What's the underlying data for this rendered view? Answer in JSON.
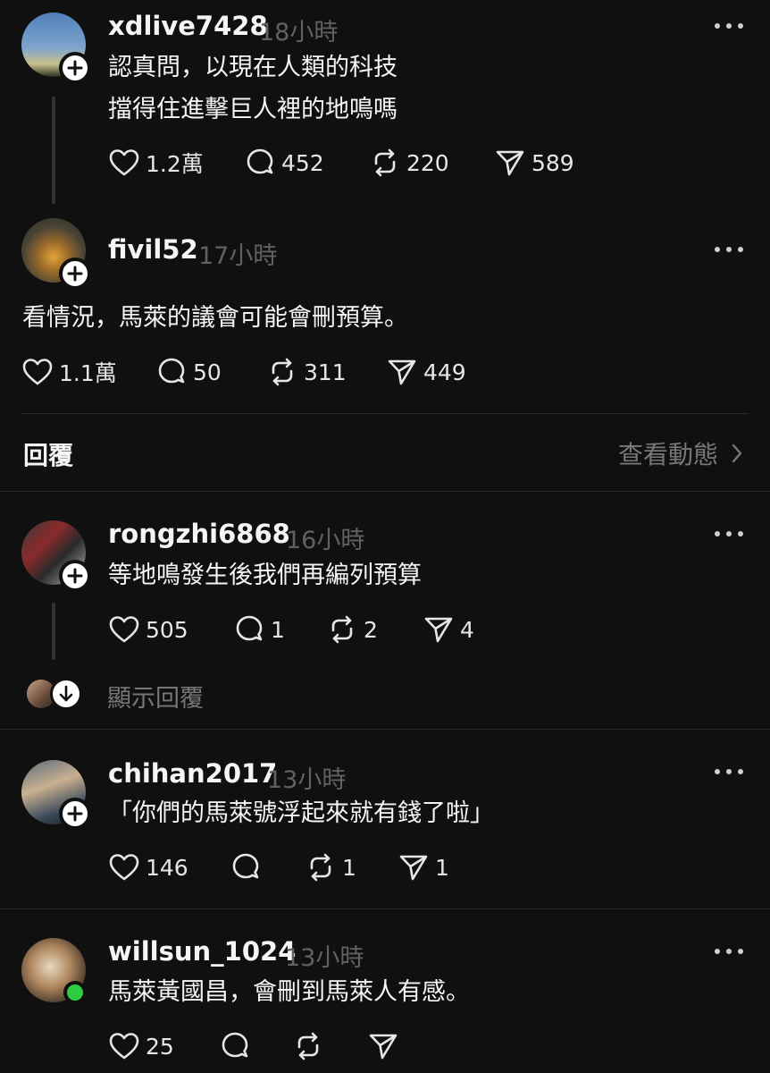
{
  "posts": [
    {
      "username": "xdlive7428",
      "time": "18小時",
      "lines": [
        "認真問，以現在人類的科技",
        "擋得住進擊巨人裡的地鳴嗎"
      ],
      "likes": "1.2萬",
      "comments": "452",
      "reposts": "220",
      "shares": "589"
    },
    {
      "username": "fivil52",
      "time": "17小時",
      "lines": [
        "看情況，馬萊的議會可能會刪預算。"
      ],
      "likes": "1.1萬",
      "comments": "50",
      "reposts": "311",
      "shares": "449"
    }
  ],
  "replies_section": {
    "title": "回覆",
    "activity_link": "查看動態"
  },
  "replies": [
    {
      "username": "rongzhi6868",
      "time": "16小時",
      "lines": [
        "等地鳴發生後我們再編列預算"
      ],
      "likes": "505",
      "comments": "1",
      "reposts": "2",
      "shares": "4",
      "show_replies": "顯示回覆"
    },
    {
      "username": "chihan2017",
      "time": "13小時",
      "lines": [
        "「你們的馬萊號浮起來就有錢了啦」"
      ],
      "likes": "146",
      "comments": "",
      "reposts": "1",
      "shares": "1"
    },
    {
      "username": "willsun_1024",
      "time": "13小時",
      "lines": [
        "馬萊黃國昌，會刪到馬萊人有感。"
      ],
      "likes": "25",
      "comments": "",
      "reposts": "",
      "shares": ""
    }
  ],
  "icons": {
    "like": "heart-icon",
    "comment": "comment-bubble-icon",
    "repost": "repost-icon",
    "share": "send-icon",
    "more": "more-dots-icon",
    "follow": "plus-icon",
    "chevron": "chevron-right-icon"
  },
  "colors": {
    "background": "#101010",
    "text": "#f3f5f7",
    "muted": "#616161",
    "online": "#2ecc40"
  }
}
